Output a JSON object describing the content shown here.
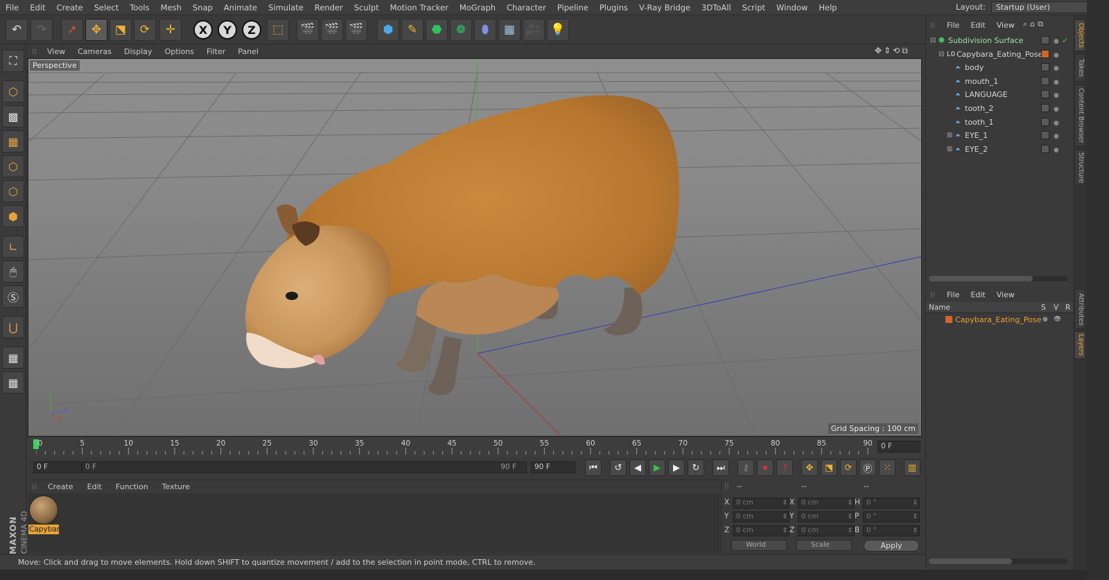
{
  "menu": [
    "File",
    "Edit",
    "Create",
    "Select",
    "Tools",
    "Mesh",
    "Snap",
    "Animate",
    "Simulate",
    "Render",
    "Sculpt",
    "Motion Tracker",
    "MoGraph",
    "Character",
    "Pipeline",
    "Plugins",
    "V-Ray Bridge",
    "3DToAll",
    "Script",
    "Window",
    "Help"
  ],
  "layout": {
    "label": "Layout:",
    "value": "Startup (User)"
  },
  "viewport": {
    "menu": [
      "View",
      "Cameras",
      "Display",
      "Options",
      "Filter",
      "Panel"
    ],
    "camera_label": "Perspective",
    "grid_spacing": "Grid Spacing : 100 cm"
  },
  "timeline": {
    "ticks": [
      "0",
      "5",
      "10",
      "15",
      "20",
      "25",
      "30",
      "35",
      "40",
      "45",
      "50",
      "55",
      "60",
      "65",
      "70",
      "75",
      "80",
      "85",
      "90"
    ],
    "current_frame": "0 F"
  },
  "transport": {
    "start": "0 F",
    "range_start": "0 F",
    "range_end": "90 F",
    "end": "90 F"
  },
  "material_menu": [
    "Create",
    "Edit",
    "Function",
    "Texture"
  ],
  "material": {
    "name": "Capybar"
  },
  "coords": {
    "headers": [
      "--",
      "--",
      "--"
    ],
    "rows": [
      {
        "a": "X",
        "av": "0 cm",
        "b": "X",
        "bv": "0 cm",
        "c": "H",
        "cv": "0 °"
      },
      {
        "a": "Y",
        "av": "0 cm",
        "b": "Y",
        "bv": "0 cm",
        "c": "P",
        "cv": "0 °"
      },
      {
        "a": "Z",
        "av": "0 cm",
        "b": "Z",
        "bv": "0 cm",
        "c": "B",
        "cv": "0 °"
      }
    ],
    "mode": "World",
    "scale": "Scale",
    "apply": "Apply"
  },
  "brand": {
    "maker": "MAXON",
    "product": "CINEMA 4D"
  },
  "status": "Move: Click and drag to move elements. Hold down SHIFT to quantize movement / add to the selection in point mode, CTRL to remove.",
  "objects": {
    "menu": [
      "File",
      "Edit",
      "View"
    ],
    "items": [
      {
        "name": "Subdivision Surface",
        "indent": 0,
        "color": "#9ce0a0"
      },
      {
        "name": "Capybara_Eating_Pose",
        "indent": 1,
        "color": "#d6d6d6"
      },
      {
        "name": "body",
        "indent": 2,
        "color": "#d6d6d6"
      },
      {
        "name": "mouth_1",
        "indent": 2,
        "color": "#d6d6d6"
      },
      {
        "name": "LANGUAGE",
        "indent": 2,
        "color": "#d6d6d6"
      },
      {
        "name": "tooth_2",
        "indent": 2,
        "color": "#d6d6d6"
      },
      {
        "name": "tooth_1",
        "indent": 2,
        "color": "#d6d6d6"
      },
      {
        "name": "EYE_1",
        "indent": 2,
        "color": "#d6d6d6"
      },
      {
        "name": "EYE_2",
        "indent": 2,
        "color": "#d6d6d6"
      }
    ]
  },
  "layers": {
    "menu": [
      "File",
      "Edit",
      "View"
    ],
    "header": {
      "name": "Name",
      "s": "S",
      "v": "V",
      "r": "R"
    },
    "items": [
      {
        "name": "Capybara_Eating_Pose",
        "color": "#f0a030"
      }
    ]
  },
  "side_tabs": [
    "Objects",
    "Takes",
    "Content Browser",
    "Structure",
    "Attributes",
    "Layers"
  ]
}
